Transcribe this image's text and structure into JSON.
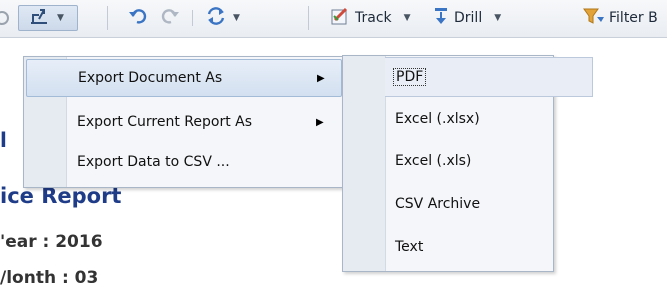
{
  "toolbar": {
    "track_label": "Track",
    "drill_label": "Drill",
    "filter_label": "Filter B",
    "icons": {
      "export": "export-icon",
      "undo": "undo-icon",
      "redo": "redo-icon",
      "refresh": "refresh-icon",
      "track": "track-icon",
      "drill": "drill-icon",
      "filter": "filter-bar-icon"
    },
    "accent_color": "#3a74c4"
  },
  "report": {
    "title_partial": "l",
    "report_title_partial": "ice Report",
    "year_line": "'ear : 2016",
    "month_line": "/lonth : 03"
  },
  "export_menu": {
    "items": [
      {
        "label": "Export Document As",
        "has_submenu": true
      },
      {
        "label": "Export Current Report As",
        "has_submenu": true
      },
      {
        "label": "Export Data to CSV ...",
        "has_submenu": false
      }
    ]
  },
  "format_submenu": {
    "items": [
      {
        "label": "PDF"
      },
      {
        "label": "Excel (.xlsx)"
      },
      {
        "label": "Excel (.xls)"
      },
      {
        "label": "CSV Archive"
      },
      {
        "label": "Text"
      }
    ]
  }
}
